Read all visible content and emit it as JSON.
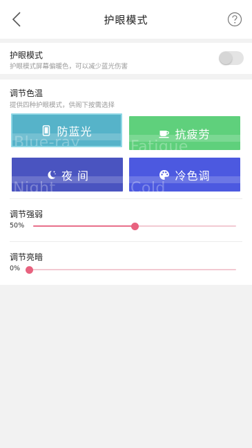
{
  "header": {
    "title": "护眼模式",
    "back_icon": "chevron-left-icon",
    "help_icon": "help-circle-icon"
  },
  "eye_mode": {
    "label": "护眼模式",
    "subtitle": "护眼模式屏幕偏暖色，可以减少蓝光伤害",
    "enabled": false
  },
  "color_temp": {
    "label": "调节色温",
    "subtitle": "提供四种护眼模式，供阁下按需选择",
    "modes": [
      {
        "label": "防蓝光",
        "bg_text": "Blue-ray",
        "icon": "phone-icon",
        "color": "#56b3c9",
        "selected": true
      },
      {
        "label": "抗疲劳",
        "bg_text": "Fatigue",
        "icon": "coffee-cup-icon",
        "color": "#5fd07c",
        "selected": false
      },
      {
        "label": "夜 间",
        "bg_text": "Night",
        "icon": "moon-icon",
        "color": "#4a54c0",
        "selected": false
      },
      {
        "label": "冷色调",
        "bg_text": "Cold",
        "icon": "palette-icon",
        "color": "#4c59e0",
        "selected": false
      }
    ]
  },
  "strength": {
    "label": "调节强弱",
    "value_text": "50%",
    "value": 0.5
  },
  "brightness": {
    "label": "调节亮暗",
    "value_text": "0%",
    "value": 0.0
  },
  "colors": {
    "accent": "#e8627f",
    "track": "#f2c9d2"
  }
}
